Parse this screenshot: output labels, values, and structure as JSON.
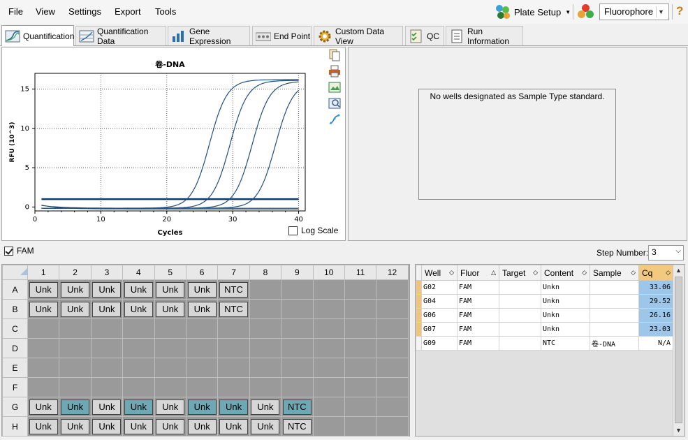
{
  "menu": [
    "File",
    "View",
    "Settings",
    "Export",
    "Tools"
  ],
  "toolbar": {
    "plate_setup": "Plate Setup",
    "fluorophore": "Fluorophore",
    "help": "?"
  },
  "tabs": [
    "Quantification",
    "Quantification Data",
    "Gene Expression",
    "End Point",
    "Custom Data View",
    "QC",
    "Run Information"
  ],
  "chart_data": {
    "type": "line",
    "title": "卷-DNA",
    "xlabel": "Cycles",
    "ylabel": "RFU (10^3)",
    "xlim": [
      0,
      41
    ],
    "ylim": [
      -0.5,
      17
    ],
    "xticks": [
      0,
      10,
      20,
      30,
      40
    ],
    "yticks": [
      0,
      5,
      10,
      15
    ],
    "grid": true,
    "threshold": 1.0,
    "series": [
      {
        "cq": 23.03,
        "plateau": 16.2
      },
      {
        "cq": 26.16,
        "plateau": 16.1
      },
      {
        "cq": 29.52,
        "plateau": 16.0
      },
      {
        "cq": 33.06,
        "plateau": 15.9
      }
    ],
    "log_scale_label": "Log Scale"
  },
  "standard_message": "No wells designated as Sample Type standard.",
  "fam_label": "FAM",
  "step": {
    "label": "Step Number:",
    "value": "3"
  },
  "plate": {
    "columns": [
      "1",
      "2",
      "3",
      "4",
      "5",
      "6",
      "7",
      "8",
      "9",
      "10",
      "11",
      "12"
    ],
    "rows": [
      {
        "label": "A",
        "wells": [
          {
            "t": "Unk",
            "s": false
          },
          {
            "t": "Unk",
            "s": false
          },
          {
            "t": "Unk",
            "s": false
          },
          {
            "t": "Unk",
            "s": false
          },
          {
            "t": "Unk",
            "s": false
          },
          {
            "t": "Unk",
            "s": false
          },
          {
            "t": "NTC",
            "s": false
          },
          null,
          null,
          null,
          null,
          null
        ]
      },
      {
        "label": "B",
        "wells": [
          {
            "t": "Unk",
            "s": false
          },
          {
            "t": "Unk",
            "s": false
          },
          {
            "t": "Unk",
            "s": false
          },
          {
            "t": "Unk",
            "s": false
          },
          {
            "t": "Unk",
            "s": false
          },
          {
            "t": "Unk",
            "s": false
          },
          {
            "t": "NTC",
            "s": false
          },
          null,
          null,
          null,
          null,
          null
        ]
      },
      {
        "label": "C",
        "wells": [
          null,
          null,
          null,
          null,
          null,
          null,
          null,
          null,
          null,
          null,
          null,
          null
        ]
      },
      {
        "label": "D",
        "wells": [
          null,
          null,
          null,
          null,
          null,
          null,
          null,
          null,
          null,
          null,
          null,
          null
        ]
      },
      {
        "label": "E",
        "wells": [
          null,
          null,
          null,
          null,
          null,
          null,
          null,
          null,
          null,
          null,
          null,
          null
        ]
      },
      {
        "label": "F",
        "wells": [
          null,
          null,
          null,
          null,
          null,
          null,
          null,
          null,
          null,
          null,
          null,
          null
        ]
      },
      {
        "label": "G",
        "wells": [
          {
            "t": "Unk",
            "s": false
          },
          {
            "t": "Unk",
            "s": true
          },
          {
            "t": "Unk",
            "s": false
          },
          {
            "t": "Unk",
            "s": true
          },
          {
            "t": "Unk",
            "s": false
          },
          {
            "t": "Unk",
            "s": true
          },
          {
            "t": "Unk",
            "s": true
          },
          {
            "t": "Unk",
            "s": false
          },
          {
            "t": "NTC",
            "s": true
          },
          null,
          null,
          null
        ]
      },
      {
        "label": "H",
        "wells": [
          {
            "t": "Unk",
            "s": false
          },
          {
            "t": "Unk",
            "s": false
          },
          {
            "t": "Unk",
            "s": false
          },
          {
            "t": "Unk",
            "s": false
          },
          {
            "t": "Unk",
            "s": false
          },
          {
            "t": "Unk",
            "s": false
          },
          {
            "t": "Unk",
            "s": false
          },
          {
            "t": "Unk",
            "s": false
          },
          {
            "t": "NTC",
            "s": false
          },
          null,
          null,
          null
        ]
      }
    ]
  },
  "results": {
    "headers": [
      "Well",
      "Fluor",
      "Target",
      "Content",
      "Sample",
      "Cq"
    ],
    "rows": [
      {
        "well": "G02",
        "fluor": "FAM",
        "target": "",
        "content": "Unkn",
        "sample": "",
        "cq": "33.06",
        "hl": true
      },
      {
        "well": "G04",
        "fluor": "FAM",
        "target": "",
        "content": "Unkn",
        "sample": "",
        "cq": "29.52",
        "hl": true
      },
      {
        "well": "G06",
        "fluor": "FAM",
        "target": "",
        "content": "Unkn",
        "sample": "",
        "cq": "26.16",
        "hl": true
      },
      {
        "well": "G07",
        "fluor": "FAM",
        "target": "",
        "content": "Unkn",
        "sample": "",
        "cq": "23.03",
        "hl": true
      },
      {
        "well": "G09",
        "fluor": "FAM",
        "target": "",
        "content": "NTC",
        "sample": "卷-DNA",
        "cq": "N/A",
        "hl": false
      }
    ]
  }
}
